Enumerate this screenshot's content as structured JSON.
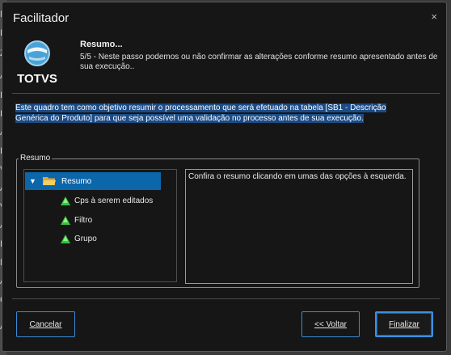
{
  "background": {
    "left_chars": [
      "N",
      "Ir",
      "Z",
      "A",
      "I",
      "I",
      "A",
      "I",
      "V",
      "A",
      "V",
      "A",
      "I",
      "N",
      "A",
      "C",
      "A"
    ]
  },
  "dialog": {
    "title": "Facilitador",
    "close_symbol": "×",
    "logo_text": "TOTVS",
    "step_title": "Resumo...",
    "step_description": "5/5 - Neste passo podemos ou não confirmar as alterações conforme resumo apresentado antes de sua execução..",
    "info_text": "Este quadro tem como objetivo resumir o processamento que será efetuado na tabela [SB1 - Descrição Genérica do Produto] para que seja possível uma validação no processo antes de sua execução.",
    "group_label": "Resumo",
    "tree": {
      "root_label": "Resumo",
      "children": [
        "Cps à serem editados",
        "Filtro",
        "Grupo"
      ]
    },
    "summary_text": "Confira o resumo clicando em umas das opções à esquerda.",
    "buttons": {
      "cancel": "Cancelar",
      "back": "<< Voltar",
      "finish": "Finalizar"
    }
  },
  "colors": {
    "background": "#161616",
    "selection": "#0c66aa",
    "accent_border": "#3a8ad6",
    "highlight": "#1c4c86"
  }
}
